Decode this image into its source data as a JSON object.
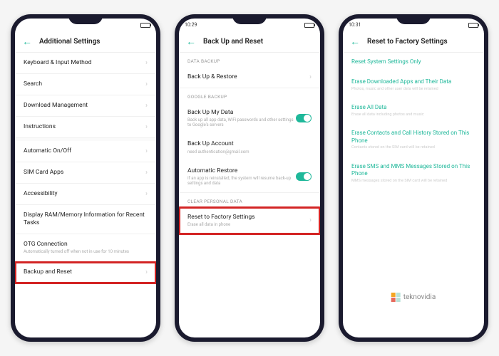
{
  "phone1": {
    "time": "",
    "title": "Additional Settings",
    "items": [
      {
        "label": "Keyboard & Input Method"
      },
      {
        "label": "Search"
      },
      {
        "label": "Download Management"
      },
      {
        "label": "Instructions"
      },
      {
        "label": "Automatic On/Off"
      },
      {
        "label": "SIM Card Apps"
      },
      {
        "label": "Accessibility"
      },
      {
        "label": "Display RAM/Memory Information for Recent Tasks"
      },
      {
        "label": "OTG Connection",
        "sub": "Automatically turned off when not in use for 10 minutes"
      },
      {
        "label": "Backup and Reset"
      }
    ]
  },
  "phone2": {
    "time": "10:29",
    "title": "Back Up and Reset",
    "sections": {
      "data_backup": "DATA BACKUP",
      "google_backup": "GOOGLE BACKUP",
      "clear_personal": "CLEAR PERSONAL DATA"
    },
    "items": {
      "backup_restore": "Back Up & Restore",
      "backup_mydata": {
        "label": "Back Up My Data",
        "sub": "Back up all app data, WiFi passwords and other settings to Google's servers"
      },
      "backup_account": {
        "label": "Back Up Account",
        "sub": "need authentication@gmail.com"
      },
      "auto_restore": {
        "label": "Automatic Restore",
        "sub": "If an app is reinstalled, the system will resume back-up settings and data"
      },
      "reset_factory": {
        "label": "Reset to Factory Settings",
        "sub": "Erase all data in phone"
      }
    }
  },
  "phone3": {
    "time": "10:31",
    "title": "Reset to Factory Settings",
    "items": [
      {
        "label": "Reset System Settings Only"
      },
      {
        "label": "Erase Downloaded Apps and Their Data",
        "sub": "Photos, music and other user data will be retained"
      },
      {
        "label": "Erase All Data",
        "sub": "Erase all data including photos and music"
      },
      {
        "label": "Erase Contacts and Call History Stored on This Phone",
        "sub": "Contacts stored on the SIM card will be retained"
      },
      {
        "label": "Erase SMS and MMS Messages Stored on This Phone",
        "sub": "MMS messages stored on the SIM card will be retained"
      }
    ]
  },
  "watermark": "teknovidia"
}
